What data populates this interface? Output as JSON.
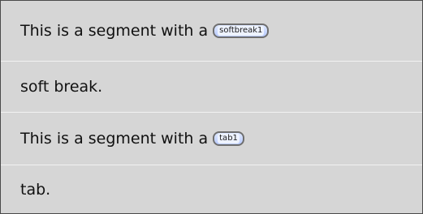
{
  "segments": [
    {
      "text": "This is a segment with a",
      "tag": "softbreak1"
    },
    {
      "text": "soft break."
    },
    {
      "text": "This is a segment with a",
      "tag": "tab1"
    },
    {
      "text": "tab."
    }
  ]
}
